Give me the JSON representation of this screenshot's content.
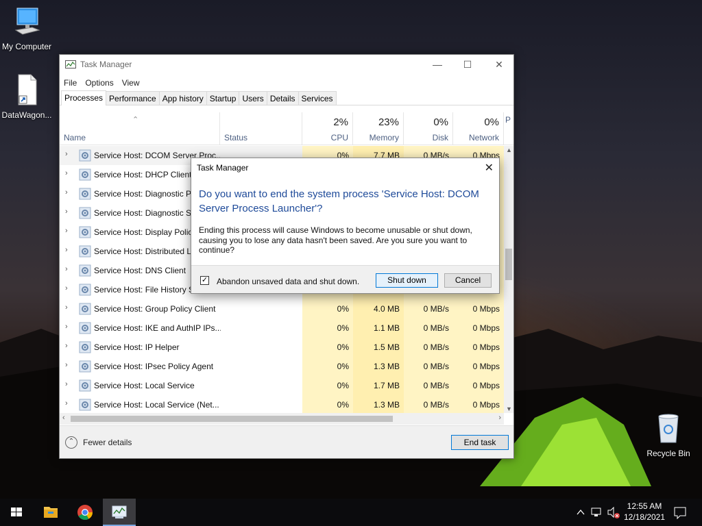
{
  "desktop": {
    "icons": [
      {
        "name": "my-computer",
        "label": "My Computer"
      },
      {
        "name": "datawagon-file",
        "label": "DataWagon..."
      },
      {
        "name": "recycle-bin",
        "label": "Recycle Bin"
      }
    ]
  },
  "task_manager": {
    "title": "Task Manager",
    "menu": [
      "File",
      "Options",
      "View"
    ],
    "tabs": [
      "Processes",
      "Performance",
      "App history",
      "Startup",
      "Users",
      "Details",
      "Services"
    ],
    "active_tab": "Processes",
    "columns": {
      "name": "Name",
      "status": "Status",
      "cpu": {
        "pct": "2%",
        "label": "CPU"
      },
      "memory": {
        "pct": "23%",
        "label": "Memory"
      },
      "disk": {
        "pct": "0%",
        "label": "Disk"
      },
      "network": {
        "pct": "0%",
        "label": "Network"
      },
      "power_partial": "P"
    },
    "processes": [
      {
        "name": "Service Host: DCOM Server Proc...",
        "cpu": "0%",
        "mem": "7.7 MB",
        "disk": "0 MB/s",
        "net": "0 Mbps"
      },
      {
        "name": "Service Host: DHCP Client",
        "cpu": "",
        "mem": "",
        "disk": "",
        "net": ""
      },
      {
        "name": "Service Host: Diagnostic Po",
        "cpu": "",
        "mem": "",
        "disk": "",
        "net": ""
      },
      {
        "name": "Service Host: Diagnostic Se",
        "cpu": "",
        "mem": "",
        "disk": "",
        "net": ""
      },
      {
        "name": "Service Host: Display Policy",
        "cpu": "",
        "mem": "",
        "disk": "",
        "net": ""
      },
      {
        "name": "Service Host: Distributed Li",
        "cpu": "",
        "mem": "",
        "disk": "",
        "net": ""
      },
      {
        "name": "Service Host: DNS Client",
        "cpu": "",
        "mem": "",
        "disk": "",
        "net": ""
      },
      {
        "name": "Service Host: File History Se",
        "cpu": "",
        "mem": "",
        "disk": "",
        "net": ""
      },
      {
        "name": "Service Host: Group Policy Client",
        "cpu": "0%",
        "mem": "4.0 MB",
        "disk": "0 MB/s",
        "net": "0 Mbps"
      },
      {
        "name": "Service Host: IKE and AuthIP IPs...",
        "cpu": "0%",
        "mem": "1.1 MB",
        "disk": "0 MB/s",
        "net": "0 Mbps"
      },
      {
        "name": "Service Host: IP Helper",
        "cpu": "0%",
        "mem": "1.5 MB",
        "disk": "0 MB/s",
        "net": "0 Mbps"
      },
      {
        "name": "Service Host: IPsec Policy Agent",
        "cpu": "0%",
        "mem": "1.3 MB",
        "disk": "0 MB/s",
        "net": "0 Mbps"
      },
      {
        "name": "Service Host: Local Service",
        "cpu": "0%",
        "mem": "1.7 MB",
        "disk": "0 MB/s",
        "net": "0 Mbps"
      },
      {
        "name": "Service Host: Local Service (Net...",
        "cpu": "0%",
        "mem": "1.3 MB",
        "disk": "0 MB/s",
        "net": "0 Mbps"
      }
    ],
    "footer": {
      "fewer_details": "Fewer details",
      "end_task": "End task"
    }
  },
  "dialog": {
    "title": "Task Manager",
    "heading": "Do you want to end the system process 'Service Host: DCOM Server Process Launcher'?",
    "body": "Ending this process will cause Windows to become unusable or shut down, causing you to lose any data hasn't been saved. Are you sure you want to continue?",
    "checkbox_label": "Abandon unsaved data and shut down.",
    "checkbox_checked": true,
    "primary_button": "Shut down",
    "cancel_button": "Cancel"
  },
  "taskbar": {
    "pinned": [
      "start-button",
      "file-explorer",
      "chrome",
      "task-manager"
    ],
    "active": "task-manager",
    "clock_time": "12:55 AM",
    "clock_date": "12/18/2021"
  },
  "colors": {
    "accent": "#0078d7",
    "heading_blue": "#1e4a99",
    "heat_cell": "#fff4c4"
  }
}
